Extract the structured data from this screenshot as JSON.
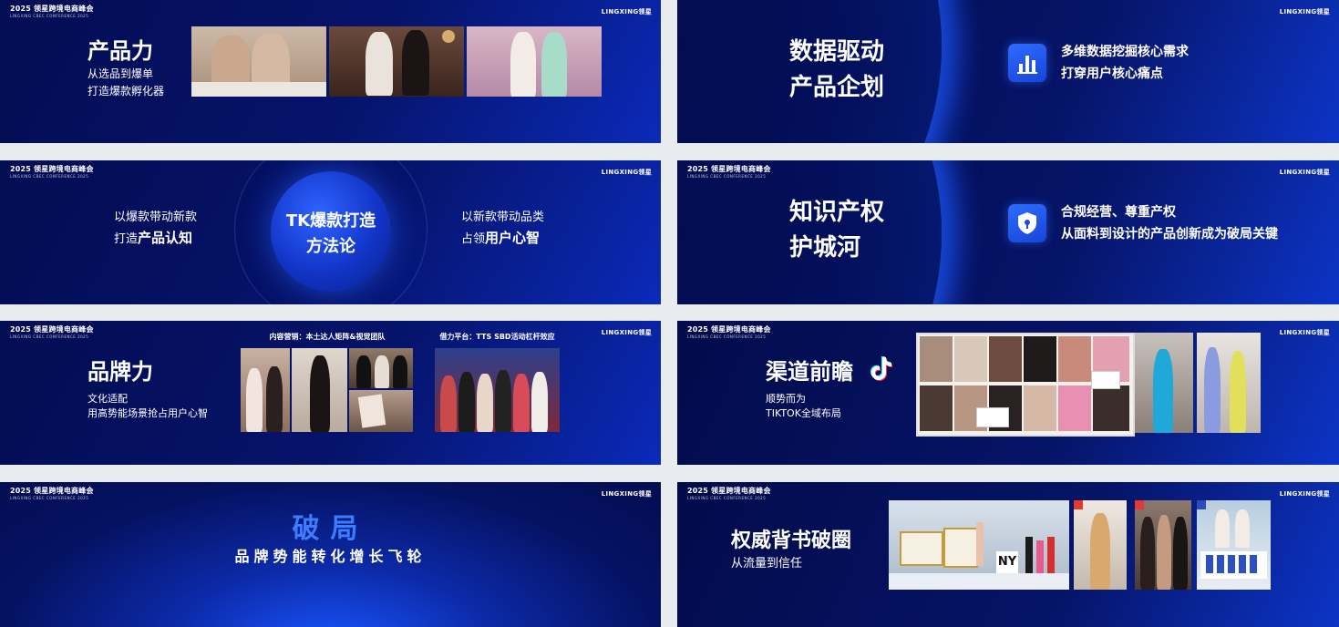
{
  "header": {
    "logo_line1": "2025 领星跨境电商峰会",
    "logo_line2": "LINGXING CBEC CONFERENCE 2025",
    "brand": "LINGXING领星"
  },
  "slides": {
    "product": {
      "title": "产品力",
      "sub1": "从选品到爆单",
      "sub2": "打造爆款孵化器"
    },
    "data": {
      "title1": "数据驱动",
      "title2": "产品企划",
      "line1": "多维数据挖掘核心需求",
      "line2": "打穿用户核心痛点",
      "icon": "bar-chart-icon"
    },
    "tk": {
      "center1": "TK爆款打造",
      "center2": "方法论",
      "left1": "以爆款带动新款",
      "left2_pre": "打造",
      "left2_bold": "产品认知",
      "right1": "以新款带动品类",
      "right2_pre": "占领",
      "right2_bold": "用户心智"
    },
    "ip": {
      "title1": "知识产权",
      "title2": "护城河",
      "line1": "合规经营、尊重产权",
      "line2": "从面料到设计的产品创新成为破局关键",
      "icon": "shield-icon"
    },
    "brand": {
      "title": "品牌力",
      "sub1": "文化适配",
      "sub2": "用高势能场景抢占用户心智",
      "cap1": "内容营销：本土达人矩阵&视觉团队",
      "cap2": "借力平台：TTS SBD活动杠杆效应"
    },
    "channel": {
      "title": "渠道前瞻",
      "sub1": "顺势而为",
      "sub2": "TIKTOK全域布局",
      "icon": "tiktok-icon"
    },
    "breakthrough": {
      "title": "破局",
      "sub": "品牌势能转化增长飞轮"
    },
    "endorse": {
      "title": "权威背书破圈",
      "sub": "从流量到信任",
      "badge": "NY"
    }
  },
  "colors": {
    "navy": "#030d52",
    "accent": "#1b4cf0",
    "highlight": "#3d7bff"
  }
}
